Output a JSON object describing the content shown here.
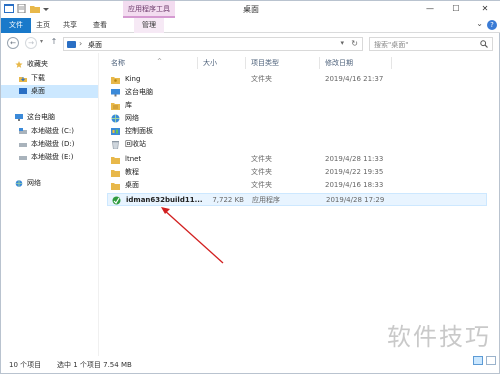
{
  "window": {
    "title": "桌面",
    "contextual_tab": "应用程序工具",
    "controls": {
      "minimize": "—",
      "maximize": "☐",
      "close": "✕"
    }
  },
  "ribbon": {
    "tabs": [
      "文件",
      "主页",
      "共享",
      "查看"
    ],
    "manage": "管理",
    "help": "?"
  },
  "address": {
    "back": "←",
    "forward": "→",
    "up": "↑",
    "separator": "›",
    "path": "桌面",
    "dropdown": "▾",
    "refresh": "↻"
  },
  "search": {
    "placeholder": "搜索\"桌面\""
  },
  "sidebar": {
    "items": [
      {
        "label": "收藏夹",
        "icon": "star-icon"
      },
      {
        "label": "下载",
        "icon": "download-icon"
      },
      {
        "label": "桌面",
        "icon": "desktop-icon"
      },
      {
        "label": "这台电脑",
        "icon": "computer-icon"
      },
      {
        "label": "本地磁盘 (C:)",
        "icon": "drive-icon"
      },
      {
        "label": "本地磁盘 (D:)",
        "icon": "drive-icon"
      },
      {
        "label": "本地磁盘 (E:)",
        "icon": "drive-icon"
      },
      {
        "label": "网络",
        "icon": "network-icon"
      }
    ]
  },
  "columns": {
    "name": "名称",
    "size": "大小",
    "type": "项目类型",
    "date": "修改日期",
    "sort_indicator": "^"
  },
  "files": [
    {
      "name": "King",
      "size": "",
      "type": "文件夹",
      "date": "2019/4/16 21:37",
      "icon": "user-folder-icon"
    },
    {
      "name": "这台电脑",
      "size": "",
      "type": "",
      "date": "",
      "icon": "computer-icon"
    },
    {
      "name": "库",
      "size": "",
      "type": "",
      "date": "",
      "icon": "library-icon"
    },
    {
      "name": "网络",
      "size": "",
      "type": "",
      "date": "",
      "icon": "network-icon"
    },
    {
      "name": "控制面板",
      "size": "",
      "type": "",
      "date": "",
      "icon": "control-panel-icon"
    },
    {
      "name": "回收站",
      "size": "",
      "type": "",
      "date": "",
      "icon": "recycle-bin-icon"
    },
    {
      "name": "ltnet",
      "size": "",
      "type": "文件夹",
      "date": "2019/4/28 11:33",
      "icon": "folder-icon"
    },
    {
      "name": "教程",
      "size": "",
      "type": "文件夹",
      "date": "2019/4/22 19:35",
      "icon": "folder-icon"
    },
    {
      "name": "桌面",
      "size": "",
      "type": "文件夹",
      "date": "2019/4/16 18:33",
      "icon": "folder-icon"
    },
    {
      "name": "idman632build11...",
      "size": "7,722 KB",
      "type": "应用程序",
      "date": "2019/4/28 17:29",
      "icon": "installer-icon"
    }
  ],
  "status": {
    "count": "10 个项目",
    "selection": "选中 1 个项目  7.54 MB"
  },
  "watermark": "软件技巧",
  "colors": {
    "accent": "#1979ca",
    "selection": "#cce8ff",
    "folder": "#e8b84a",
    "arrow": "#d21f1f"
  }
}
